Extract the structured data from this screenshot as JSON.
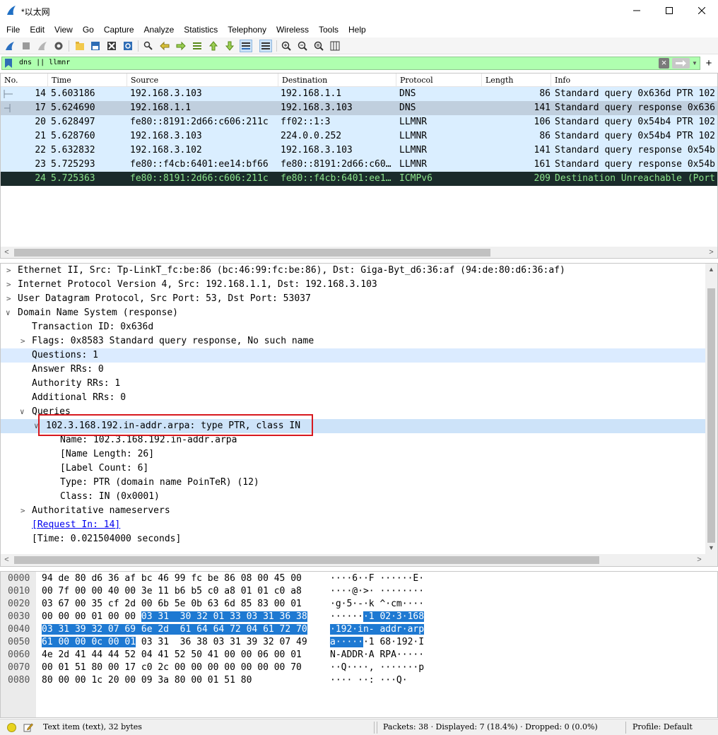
{
  "window": {
    "title": "*以太网"
  },
  "menu": [
    "File",
    "Edit",
    "View",
    "Go",
    "Capture",
    "Analyze",
    "Statistics",
    "Telephony",
    "Wireless",
    "Tools",
    "Help"
  ],
  "filter": {
    "text": "dns || llmnr"
  },
  "packet_list": {
    "columns": [
      "No.",
      "Time",
      "Source",
      "Destination",
      "Protocol",
      "Length",
      "Info"
    ],
    "rows": [
      {
        "no": "14",
        "time": "5.603186",
        "source": "192.168.3.103",
        "destination": "192.168.1.1",
        "protocol": "DNS",
        "length": "86",
        "info": "Standard query 0x636d PTR 102"
      },
      {
        "no": "17",
        "time": "5.624690",
        "source": "192.168.1.1",
        "destination": "192.168.3.103",
        "protocol": "DNS",
        "length": "141",
        "info": "Standard query response 0x636"
      },
      {
        "no": "20",
        "time": "5.628497",
        "source": "fe80::8191:2d66:c606:211c",
        "destination": "ff02::1:3",
        "protocol": "LLMNR",
        "length": "106",
        "info": "Standard query 0x54b4 PTR 102"
      },
      {
        "no": "21",
        "time": "5.628760",
        "source": "192.168.3.103",
        "destination": "224.0.0.252",
        "protocol": "LLMNR",
        "length": "86",
        "info": "Standard query 0x54b4 PTR 102"
      },
      {
        "no": "22",
        "time": "5.632832",
        "source": "192.168.3.102",
        "destination": "192.168.3.103",
        "protocol": "LLMNR",
        "length": "141",
        "info": "Standard query response 0x54b"
      },
      {
        "no": "23",
        "time": "5.725293",
        "source": "fe80::f4cb:6401:ee14:bf66",
        "destination": "fe80::8191:2d66:c60…",
        "protocol": "LLMNR",
        "length": "161",
        "info": "Standard query response 0x54b"
      },
      {
        "no": "24",
        "time": "5.725363",
        "source": "fe80::8191:2d66:c606:211c",
        "destination": "fe80::f4cb:6401:ee1…",
        "protocol": "ICMPv6",
        "length": "209",
        "info": "Destination Unreachable (Port"
      }
    ]
  },
  "details": [
    "Ethernet II, Src: Tp-LinkT_fc:be:86 (bc:46:99:fc:be:86), Dst: Giga-Byt_d6:36:af (94:de:80:d6:36:af)",
    "Internet Protocol Version 4, Src: 192.168.1.1, Dst: 192.168.3.103",
    "User Datagram Protocol, Src Port: 53, Dst Port: 53037",
    "Domain Name System (response)",
    "Transaction ID: 0x636d",
    "Flags: 0x8583 Standard query response, No such name",
    "Questions: 1",
    "Answer RRs: 0",
    "Authority RRs: 1",
    "Additional RRs: 0",
    "Queries",
    "102.3.168.192.in-addr.arpa: type PTR, class IN",
    "Name: 102.3.168.192.in-addr.arpa",
    "[Name Length: 26]",
    "[Label Count: 6]",
    "Type: PTR (domain name PoinTeR) (12)",
    "Class: IN (0x0001)",
    "Authoritative nameservers",
    "[Request In: 14]",
    "[Time: 0.021504000 seconds]"
  ],
  "bytes": [
    {
      "off": "0000",
      "hex_a": "94 de 80 d6 36 af bc 46  99 fc be 86 08 00 45 00",
      "hex_s": "",
      "hex_b": "",
      "asc_a": "····6··F ······E·",
      "asc_s": "",
      "asc_b": ""
    },
    {
      "off": "0010",
      "hex_a": "00 7f 00 00 40 00 3e 11  b6 b5 c0 a8 01 01 c0 a8",
      "hex_s": "",
      "hex_b": "",
      "asc_a": "····@·>· ········",
      "asc_s": "",
      "asc_b": ""
    },
    {
      "off": "0020",
      "hex_a": "03 67 00 35 cf 2d 00 6b  5e 0b 63 6d 85 83 00 01",
      "hex_s": "",
      "hex_b": "",
      "asc_a": "·g·5·-·k ^·cm····",
      "asc_s": "",
      "asc_b": ""
    },
    {
      "off": "0030",
      "hex_a": "00 00 00 01 00 00 ",
      "hex_s": "03 31  30 32 01 33 03 31 36 38",
      "hex_b": "",
      "asc_a": "······",
      "asc_s": "·1 02·3·168",
      "asc_b": ""
    },
    {
      "off": "0040",
      "hex_a": "",
      "hex_s": "03 31 39 32 07 69 6e 2d  61 64 64 72 04 61 72 70",
      "hex_b": "",
      "asc_a": "",
      "asc_s": "·192·in- addr·arp",
      "asc_b": ""
    },
    {
      "off": "0050",
      "hex_a": "",
      "hex_s": "61 00 00 0c 00 01",
      "hex_b": " 03 31  36 38 03 31 39 32 07 49",
      "asc_a": "",
      "asc_s": "a·····",
      "asc_b": "·1 68·192·I"
    },
    {
      "off": "0060",
      "hex_a": "4e 2d 41 44 44 52 04 41  52 50 41 00 00 06 00 01",
      "hex_s": "",
      "hex_b": "",
      "asc_a": "N-ADDR·A RPA·····",
      "asc_s": "",
      "asc_b": ""
    },
    {
      "off": "0070",
      "hex_a": "00 01 51 80 00 17 c0 2c  00 00 00 00 00 00 00 70",
      "hex_s": "",
      "hex_b": "",
      "asc_a": "··Q····, ·······p",
      "asc_s": "",
      "asc_b": ""
    },
    {
      "off": "0080",
      "hex_a": "80 00 00 1c 20 00 09 3a  80 00 01 51 80",
      "hex_s": "",
      "hex_b": "",
      "asc_a": "···· ··: ···Q·",
      "asc_s": "",
      "asc_b": ""
    }
  ],
  "status": {
    "item": "Text item (text), 32 bytes",
    "packets": "Packets: 38 · Displayed: 7 (18.4%) · Dropped: 0 (0.0%)",
    "profile": "Profile: Default"
  },
  "colors": {
    "filter_valid": "#afffaf",
    "dns_row": "#daeeff",
    "selected_row": "#1a2b2a",
    "selected_text": "#8ce38c",
    "byte_selection": "#1e79d2",
    "highlight_box": "#d7191f"
  }
}
